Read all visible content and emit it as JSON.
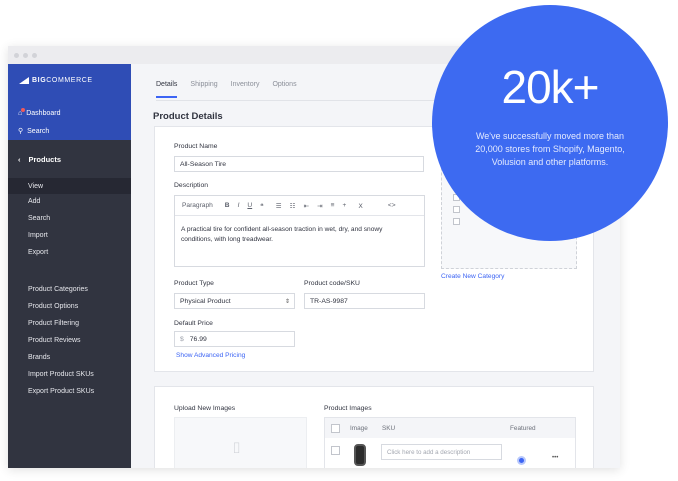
{
  "sidebar": {
    "logo_big": "BIG",
    "logo_rest": "COMMERCE",
    "dashboard": "Dashboard",
    "search": "Search",
    "section": "Products",
    "items": [
      "View",
      "Add",
      "Search",
      "Import",
      "Export"
    ],
    "more": [
      "Product Categories",
      "Product Options",
      "Product Filtering",
      "Product Reviews",
      "Brands",
      "Import Product SKUs",
      "Export Product SKUs"
    ]
  },
  "tabs": [
    "Details",
    "Shipping",
    "Inventory",
    "Options"
  ],
  "section_title": "Product Details",
  "form": {
    "name_label": "Product Name",
    "name_value": "All-Season Tire",
    "desc_label": "Description",
    "toolbar": [
      "Paragraph",
      "B",
      "I",
      "U",
      "❝",
      "☰",
      "☷",
      "⇤",
      "⇥",
      "≡",
      "+",
      "Ⅹ",
      "<>"
    ],
    "desc_value": "A practical tire for confident all-season traction in wet, dry, and snowy conditions, with long treadwear.",
    "type_label": "Product Type",
    "type_value": "Physical Product",
    "sku_label": "Product code/SKU",
    "sku_value": "TR-AS-9987",
    "price_label": "Default Price",
    "currency": "$",
    "price_value": "76.99",
    "advanced_link": "Show Advanced Pricing",
    "create_category": "Create New Category"
  },
  "images": {
    "upload_label": "Upload New Images",
    "product_images": "Product Images",
    "col_image": "Image",
    "col_sku": "SKU",
    "col_featured": "Featured",
    "desc_placeholder": "Click here to add a description",
    "more": "•••"
  },
  "promo": {
    "headline": "20k+",
    "text": "We've successfully moved more than 20,000 stores from Shopify, Magento, Volusion and other platforms."
  },
  "colors": {
    "sidebar": "#313440",
    "sidebar_top": "#2f4db5",
    "accent": "#3c64f4",
    "promo": "#3d6af1"
  },
  "icons": {
    "window_dots": "dot",
    "dashboard": "home-icon",
    "search": "search-icon",
    "back": "chevron-left-icon",
    "upload": "camera-icon",
    "tire": "tire-icon"
  }
}
